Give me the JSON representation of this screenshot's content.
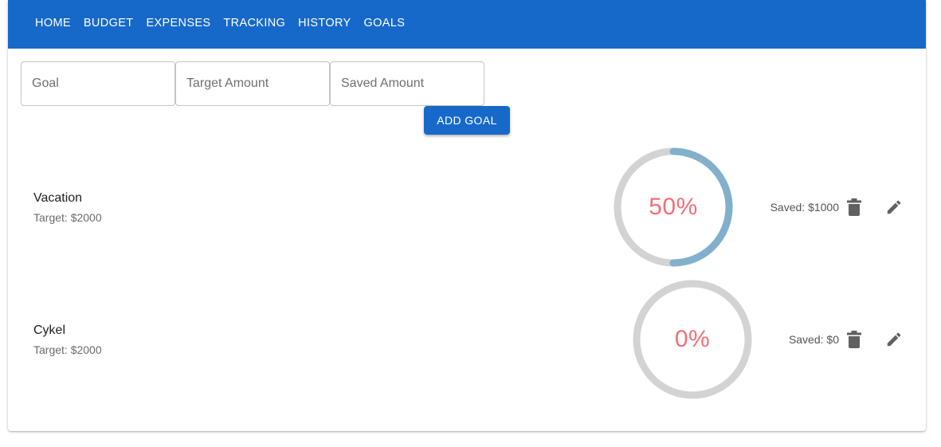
{
  "nav": {
    "items": [
      {
        "label": "HOME"
      },
      {
        "label": "BUDGET"
      },
      {
        "label": "EXPENSES"
      },
      {
        "label": "TRACKING"
      },
      {
        "label": "HISTORY"
      },
      {
        "label": "GOALS"
      }
    ]
  },
  "form": {
    "goal": {
      "placeholder": "Goal",
      "value": ""
    },
    "target_amount": {
      "placeholder": "Target Amount",
      "value": ""
    },
    "saved_amount": {
      "placeholder": "Saved Amount",
      "value": ""
    },
    "add_label": "ADD GOAL"
  },
  "goals": [
    {
      "name": "Vacation",
      "target": "Target: $2000",
      "percent": 50,
      "percent_label": "50%",
      "saved": "Saved: $1000"
    },
    {
      "name": "Cykel",
      "target": "Target: $2000",
      "percent": 0,
      "percent_label": "0%",
      "saved": "Saved: $0"
    }
  ],
  "colors": {
    "primary": "#1769c9",
    "ring_track": "#d3d3d3",
    "ring_progress": "#82b0cc",
    "percent_text": "#f06f78",
    "icon": "#616161"
  },
  "icons": {
    "delete": "trash-icon",
    "edit": "pencil-icon"
  }
}
